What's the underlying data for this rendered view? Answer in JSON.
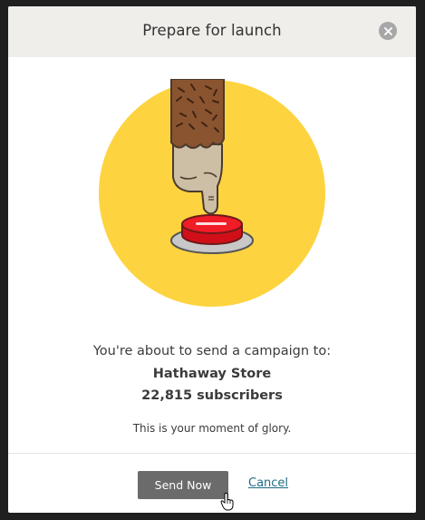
{
  "dialog": {
    "title": "Prepare for launch",
    "close_icon": "close-icon"
  },
  "illustration": {
    "icon": "finger-pressing-red-button",
    "colors": {
      "circle": "#fdd33f",
      "button": "#e3111b",
      "plate": "#c4c4c4",
      "sleeve": "#8a5430",
      "skin": "#cdbfa5"
    }
  },
  "body": {
    "intro": "You're about to send a campaign to:",
    "list_name": "Hathaway Store",
    "subscribers": "22,815 subscribers",
    "tagline": "This is your moment of glory."
  },
  "footer": {
    "send_label": "Send Now",
    "cancel_label": "Cancel"
  },
  "colors": {
    "header_bg": "#efeeea",
    "send_button": "#6b6b6b",
    "link": "#1f6c85"
  }
}
